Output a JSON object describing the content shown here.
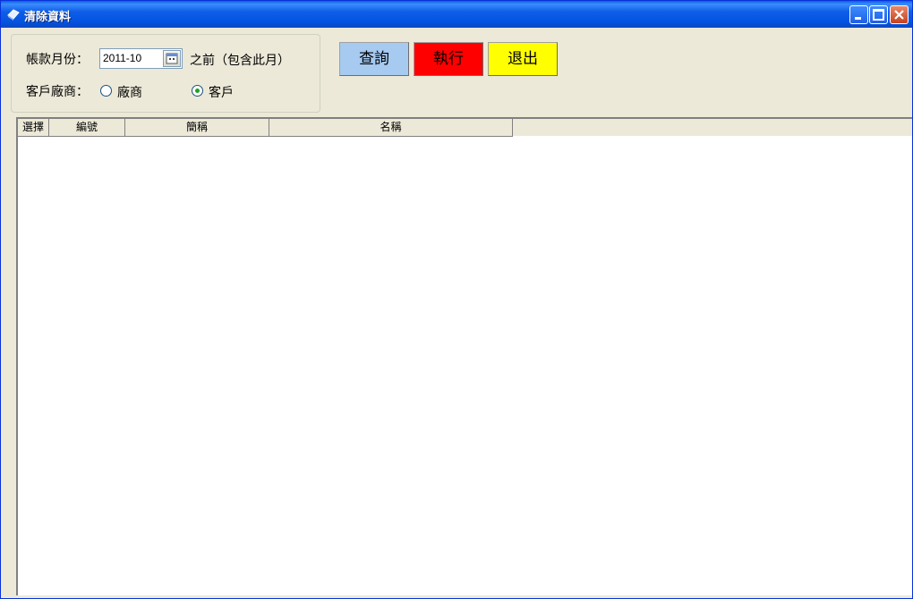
{
  "window": {
    "title": "清除資料"
  },
  "form": {
    "month_label": "帳款月份：",
    "month_value": "2011-10",
    "month_suffix": "之前（包含此月）",
    "type_label": "客戶廠商：",
    "radio_vendor": "廠商",
    "radio_customer": "客戶",
    "selected": "客戶"
  },
  "buttons": {
    "query": {
      "label": "查詢",
      "color": "#a6caf0"
    },
    "execute": {
      "label": "執行",
      "color": "#ff0000"
    },
    "exit": {
      "label": "退出",
      "color": "#ffff00"
    }
  },
  "grid": {
    "columns": [
      "選擇",
      "編號",
      "簡稱",
      "名稱"
    ],
    "rows": []
  }
}
